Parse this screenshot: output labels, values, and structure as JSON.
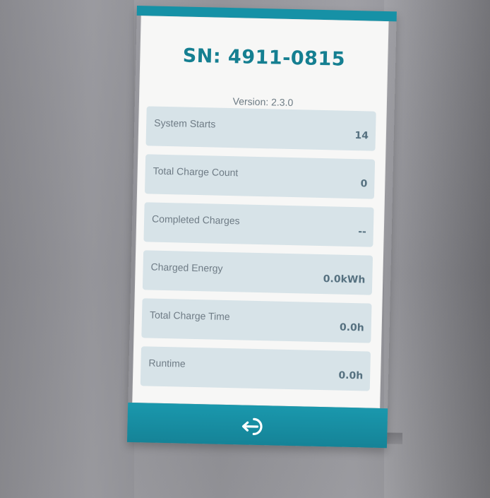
{
  "header": {
    "title_fragment": "........"
  },
  "device": {
    "serial": "SN: 4911-0815",
    "version": "Version: 2.3.0"
  },
  "stats": [
    {
      "label": "System Starts",
      "value": "14"
    },
    {
      "label": "Total Charge Count",
      "value": "0"
    },
    {
      "label": "Completed Charges",
      "value": "--"
    },
    {
      "label": "Charged Energy",
      "value": "0.0kWh"
    },
    {
      "label": "Total Charge Time",
      "value": "0.0h"
    },
    {
      "label": "Runtime",
      "value": "0.0h"
    }
  ],
  "footer": {
    "back_icon": "back-exit-icon"
  },
  "colors": {
    "accent": "#1691a6",
    "serial_text": "#157f91",
    "row_background": "#d7e3e8",
    "screen_background": "#f7f7f6"
  }
}
